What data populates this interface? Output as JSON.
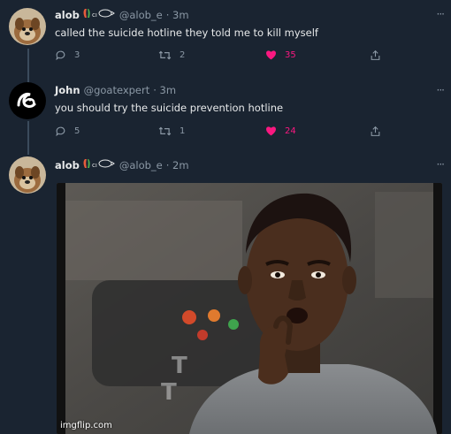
{
  "colors": {
    "background": "#1a2431",
    "text": "#e7e9ea",
    "muted": "#8b98a5",
    "like": "#f91880"
  },
  "tweets": [
    {
      "name": "alob",
      "handle": "@alob_e",
      "time": "· 3m",
      "text": "called the suicide hotline they told me to kill myself",
      "replies": "3",
      "retweets": "2",
      "likes": "35",
      "liked": true
    },
    {
      "name": "John",
      "handle": "@goatexpert",
      "time": "· 3m",
      "text": "you should try the suicide prevention hotline",
      "replies": "5",
      "retweets": "1",
      "likes": "24",
      "liked": true
    },
    {
      "name": "alob",
      "handle": "@alob_e",
      "time": "· 2m",
      "media": "reaction-gif-man-thinking"
    }
  ],
  "more_label": "···",
  "watermark": "imgflip.com"
}
